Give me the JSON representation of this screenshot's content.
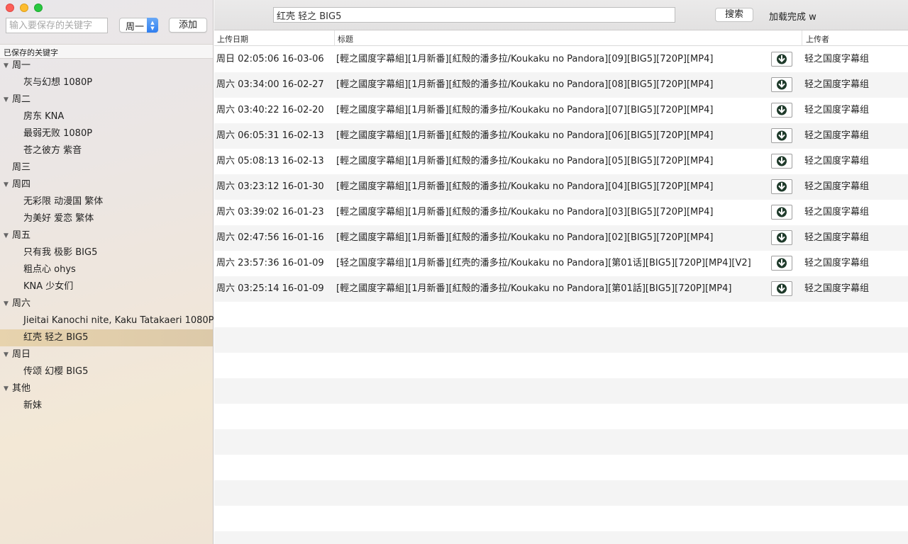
{
  "window": {
    "traffic_lights": {
      "close": "#fc5f57",
      "minimize": "#fdbc2e",
      "maximize": "#28c840"
    }
  },
  "sidebar": {
    "keyword_placeholder": "输入要保存的关键字",
    "day_select": "周一",
    "add_label": "添加",
    "saved_header": "已保存的关键字",
    "tree": [
      {
        "label": "周一",
        "expanded": true,
        "children": [
          "灰与幻想 1080P"
        ]
      },
      {
        "label": "周二",
        "expanded": true,
        "children": [
          "房东 KNA",
          "最弱无败 1080P",
          "苍之彼方 紫音"
        ]
      },
      {
        "label": "周三",
        "expanded": false,
        "children": []
      },
      {
        "label": "周四",
        "expanded": true,
        "children": [
          "无彩限 动漫国 繁体",
          "为美好 爱恋 繁体"
        ]
      },
      {
        "label": "周五",
        "expanded": true,
        "children": [
          "只有我 极影 BIG5",
          "粗点心 ohys",
          "KNA 少女们"
        ]
      },
      {
        "label": "周六",
        "expanded": true,
        "children": [
          "Jieitai Kanochi nite, Kaku Tatakaeri 1080P",
          "红壳 轻之 BIG5"
        ]
      },
      {
        "label": "周日",
        "expanded": true,
        "children": [
          "传颂 幻樱 BIG5"
        ]
      },
      {
        "label": "其他",
        "expanded": true,
        "children": [
          "新妹"
        ]
      }
    ],
    "selected": "红壳 轻之 BIG5",
    "selected_color": "#e2cfac"
  },
  "toolbar": {
    "search_value": "红壳 轻之 BIG5",
    "search_label": "搜索",
    "status": "加载完成 w"
  },
  "table": {
    "headers": {
      "date": "上传日期",
      "title": "标题",
      "uploader": "上传者"
    },
    "rows": [
      {
        "date": "周日 02:05:06 16-03-06",
        "title": "[輕之國度字幕組][1月新番][紅殻的潘多拉/Koukaku no Pandora][09][BIG5][720P][MP4]",
        "uploader": "轻之国度字幕组"
      },
      {
        "date": "周六 03:34:00 16-02-27",
        "title": "[輕之國度字幕組][1月新番][紅殻的潘多拉/Koukaku no Pandora][08][BIG5][720P][MP4]",
        "uploader": "轻之国度字幕组"
      },
      {
        "date": "周六 03:40:22 16-02-20",
        "title": "[輕之國度字幕組][1月新番][紅殻的潘多拉/Koukaku no Pandora][07][BIG5][720P][MP4]",
        "uploader": "轻之国度字幕组"
      },
      {
        "date": "周六 06:05:31 16-02-13",
        "title": "[輕之國度字幕組][1月新番][紅殻的潘多拉/Koukaku no Pandora][06][BIG5][720P][MP4]",
        "uploader": "轻之国度字幕组"
      },
      {
        "date": "周六 05:08:13 16-02-13",
        "title": "[輕之國度字幕組][1月新番][紅殻的潘多拉/Koukaku no Pandora][05][BIG5][720P][MP4]",
        "uploader": "轻之国度字幕组"
      },
      {
        "date": "周六 03:23:12 16-01-30",
        "title": "[輕之國度字幕組][1月新番][紅殻的潘多拉/Koukaku no Pandora][04][BIG5][720P][MP4]",
        "uploader": "轻之国度字幕组"
      },
      {
        "date": "周六 03:39:02 16-01-23",
        "title": "[輕之國度字幕組][1月新番][紅殻的潘多拉/Koukaku no Pandora][03][BIG5][720P][MP4]",
        "uploader": "轻之国度字幕组"
      },
      {
        "date": "周六 02:47:56 16-01-16",
        "title": "[輕之國度字幕組][1月新番][紅殻的潘多拉/Koukaku no Pandora][02][BIG5][720P][MP4]",
        "uploader": "轻之国度字幕组"
      },
      {
        "date": "周六 23:57:36 16-01-09",
        "title": "[轻之国度字幕组][1月新番][红壳的潘多拉/Koukaku no Pandora][第01话][BIG5][720P][MP4][V2]",
        "uploader": "轻之国度字幕组"
      },
      {
        "date": "周六 03:25:14 16-01-09",
        "title": "[輕之國度字幕組][1月新番][紅殻的潘多拉/Koukaku no Pandora][第01話][BIG5][720P][MP4]",
        "uploader": "轻之国度字幕组"
      }
    ],
    "download_icon": "download-arrow-icon"
  }
}
